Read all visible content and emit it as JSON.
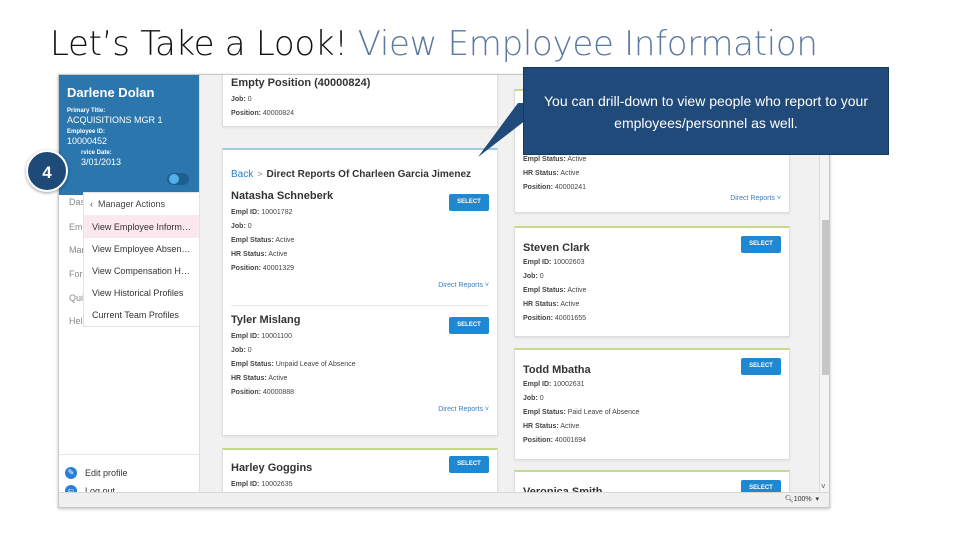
{
  "slide": {
    "title_main": "Let’s Take a Look!",
    "title_sub": "View Employee Information"
  },
  "step_number": "4",
  "callout_text": "You can drill-down to view people who report to your employees/personnel as well.",
  "profile": {
    "name": "Darlene Dolan",
    "primary_title_label": "Primary Title:",
    "primary_title": "ACQUISITIONS MGR 1",
    "employee_id_label": "Employee ID:",
    "employee_id": "10000452",
    "service_date_label": "rvice Date:",
    "service_date": "3/01/2013"
  },
  "nav_stubs": [
    "Das",
    "Emp",
    "Mar",
    "For",
    "Qui",
    "Hel"
  ],
  "submenu": {
    "header": "Manager Actions",
    "items": [
      "View Employee Informat...",
      "View Employee Absence...",
      "View Compensation Hist...",
      "View Historical Profiles",
      "Current Team Profiles"
    ]
  },
  "sidebar_bottom": {
    "edit_profile": "Edit profile",
    "log_out": "Log out"
  },
  "labels": {
    "empl_id": "Empl ID:",
    "job": "Job:",
    "position": "Position:",
    "empl_status": "Empl Status:",
    "hr_status": "HR Status:",
    "select": "SELECT",
    "direct_reports": "Direct Reports ˅"
  },
  "left_column": {
    "top_card": {
      "name": "Empty Position (40000824)",
      "job": "0",
      "position": "40000824"
    },
    "breadcrumb": {
      "back": "Back",
      "separator": ">",
      "title": "Direct Reports Of Charleen Garcia Jimenez"
    },
    "people": [
      {
        "name": "Natasha Schneberk",
        "empl_id": "10001782",
        "job": "0",
        "empl_status": "Active",
        "hr_status": "Active",
        "position": "40001329"
      },
      {
        "name": "Tyler Mislang",
        "empl_id": "10001100",
        "job": "0",
        "empl_status": "Unpaid Leave of Absence",
        "hr_status": "Active",
        "position": "40000888"
      }
    ],
    "bottom_card": {
      "name": "Harley Goggins",
      "empl_id": "10002635"
    }
  },
  "right_column": {
    "top_card": {
      "empl_status": "Active",
      "hr_status": "Active",
      "position": "40000241"
    },
    "people": [
      {
        "name": "Steven Clark",
        "empl_id": "10002603",
        "job": "0",
        "empl_status": "Active",
        "hr_status": "Active",
        "position": "40001655"
      },
      {
        "name": "Todd Mbatha",
        "empl_id": "10002631",
        "job": "0",
        "empl_status": "Paid Leave of Absence",
        "hr_status": "Active",
        "position": "40001694"
      }
    ],
    "bottom_card": {
      "name": "Veronica Smith"
    }
  },
  "statusbar": {
    "zoom": "100%"
  }
}
